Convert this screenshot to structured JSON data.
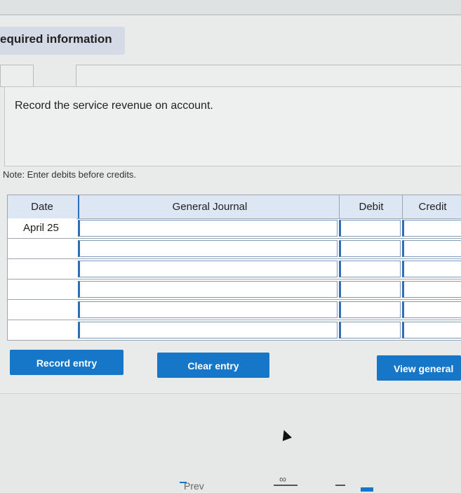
{
  "header": {
    "title": "equired information"
  },
  "prompt": {
    "text": "Record the service revenue on account."
  },
  "note": {
    "text": "Note: Enter debits before credits."
  },
  "journal": {
    "columns": {
      "date": "Date",
      "general_journal": "General Journal",
      "debit": "Debit",
      "credit": "Credit"
    },
    "rows": [
      {
        "date": "April 25"
      },
      {
        "date": ""
      },
      {
        "date": ""
      },
      {
        "date": ""
      },
      {
        "date": ""
      },
      {
        "date": ""
      }
    ]
  },
  "buttons": {
    "record_entry": "Record entry",
    "clear_entry": "Clear entry",
    "view_general": "View general"
  },
  "footer": {
    "prev_label": "Prev"
  },
  "colors": {
    "button_blue": "#1677c8",
    "header_tab": "#d4dbe6",
    "journal_header": "#dde6f3"
  }
}
